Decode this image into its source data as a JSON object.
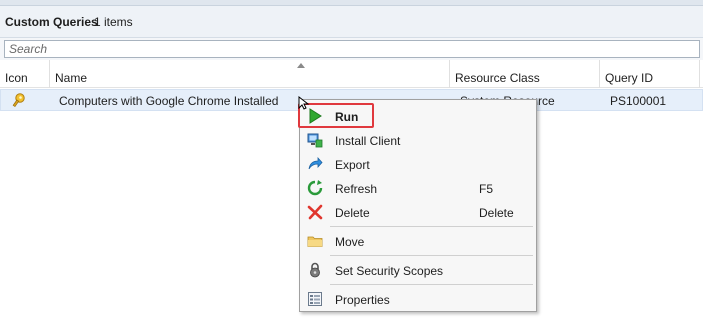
{
  "header": {
    "title": "Custom Queries",
    "count": "1 items"
  },
  "search": {
    "placeholder": "Search"
  },
  "columns": [
    {
      "label": "Icon"
    },
    {
      "label": "Name"
    },
    {
      "label": "Resource Class"
    },
    {
      "label": "Query ID"
    }
  ],
  "rows": [
    {
      "icon": "query-key-icon",
      "name": "Computers with Google Chrome Installed",
      "resource_class": "System Resource",
      "query_id": "PS100001"
    }
  ],
  "context_menu": {
    "items": [
      {
        "label": "Run",
        "icon": "run-play-icon",
        "shortcut": ""
      },
      {
        "label": "Install Client",
        "icon": "install-client-icon",
        "shortcut": ""
      },
      {
        "label": "Export",
        "icon": "export-arrow-icon",
        "shortcut": ""
      },
      {
        "label": "Refresh",
        "icon": "refresh-icon",
        "shortcut": "F5"
      },
      {
        "label": "Delete",
        "icon": "delete-x-icon",
        "shortcut": "Delete"
      },
      {
        "label": "Move",
        "icon": "folder-icon",
        "shortcut": ""
      },
      {
        "label": "Set Security Scopes",
        "icon": "lock-icon",
        "shortcut": ""
      },
      {
        "label": "Properties",
        "icon": "properties-icon",
        "shortcut": ""
      }
    ]
  },
  "colors": {
    "highlight_border": "#e0393e",
    "selected_row": "#e6effa",
    "run_green": "#2fa82f"
  }
}
